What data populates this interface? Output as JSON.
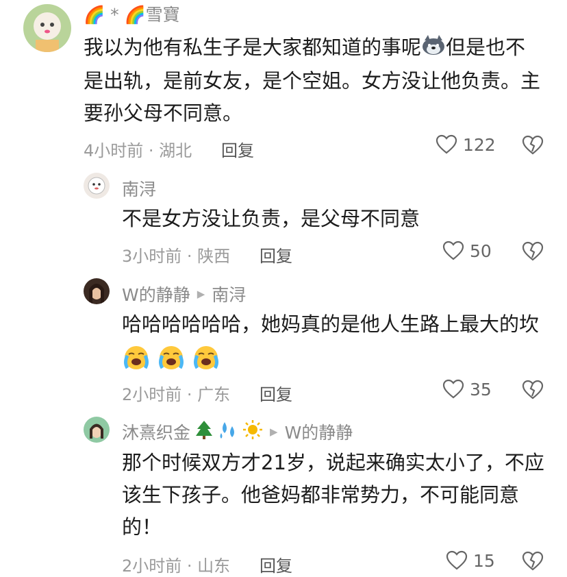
{
  "comments": [
    {
      "user": "🌈 * 🌈雪寶",
      "text_lines": [
        "我以为他有私生子是大家都知道的事呢",
        "但是也不",
        "是出轨，是前女友，是个空姐。女方没让他负责。主",
        "要孙父母不同意。"
      ],
      "meta": "4小时前 · 湖北",
      "reply_label": "回复",
      "likes": "122"
    },
    {
      "user": "南浔",
      "text": "不是女方没让负责，是父母不同意",
      "meta": "3小时前 · 陕西",
      "reply_label": "回复",
      "likes": "50"
    },
    {
      "user": "W的静静",
      "reply_to": "南浔",
      "text_lines": [
        "哈哈哈哈哈哈，她妈真的是他人生路上最大的坎"
      ],
      "meta": "2小时前 · 广东",
      "reply_label": "回复",
      "likes": "35"
    },
    {
      "user": "沐熹织金",
      "reply_to": "W的静静",
      "text_lines": [
        "那个时候双方才21岁，说起来确实太小了，不应",
        "该生下孩子。他爸妈都非常势力，不可能同意",
        "的！"
      ],
      "meta": "2小时前 · 山东",
      "reply_label": "回复",
      "likes": "15"
    }
  ],
  "icons": {
    "like": "heart-outline-icon",
    "dislike": "broken-heart-icon",
    "reply_arrow": "triangle-right-icon"
  }
}
